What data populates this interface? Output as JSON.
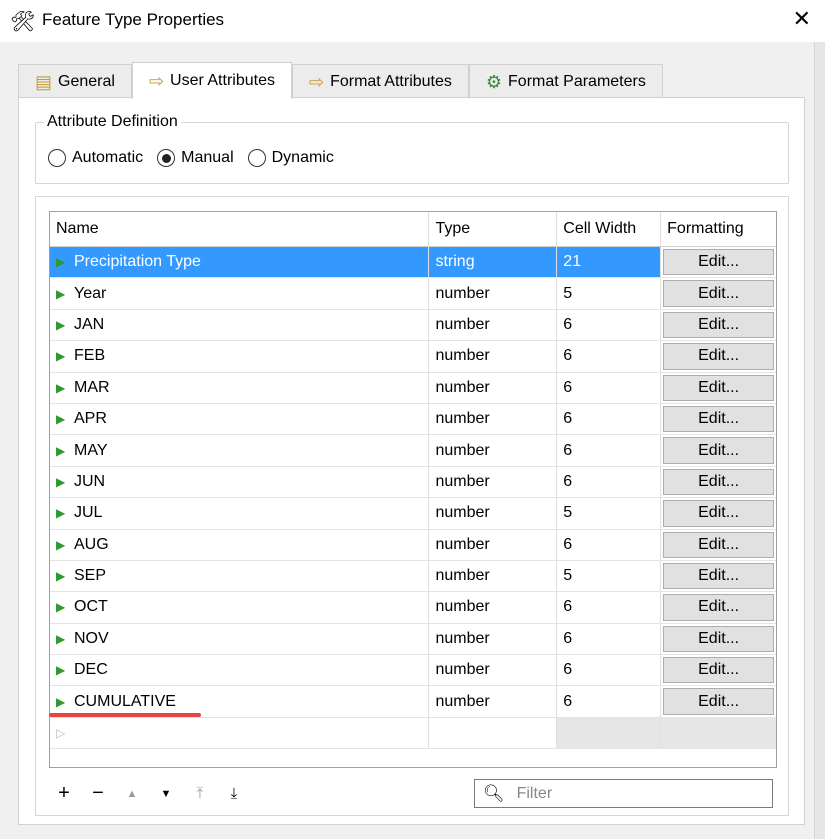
{
  "window": {
    "title": "Feature Type Properties",
    "close": "✕"
  },
  "tabs": [
    {
      "label": "General",
      "icon": "▤"
    },
    {
      "label": "User Attributes",
      "icon": "⇨"
    },
    {
      "label": "Format Attributes",
      "icon": "⇨"
    },
    {
      "label": "Format Parameters",
      "icon": "⚙"
    }
  ],
  "attr_def": {
    "label": "Attribute Definition",
    "options": [
      "Automatic",
      "Manual",
      "Dynamic"
    ],
    "selected": "Manual"
  },
  "table": {
    "headers": [
      "Name",
      "Type",
      "Cell Width",
      "Formatting"
    ],
    "rows": [
      {
        "name": "Precipitation Type",
        "type": "string",
        "width": "21",
        "fmt": "Edit..."
      },
      {
        "name": "Year",
        "type": "number",
        "width": "5",
        "fmt": "Edit..."
      },
      {
        "name": "JAN",
        "type": "number",
        "width": "6",
        "fmt": "Edit..."
      },
      {
        "name": "FEB",
        "type": "number",
        "width": "6",
        "fmt": "Edit..."
      },
      {
        "name": "MAR",
        "type": "number",
        "width": "6",
        "fmt": "Edit..."
      },
      {
        "name": "APR",
        "type": "number",
        "width": "6",
        "fmt": "Edit..."
      },
      {
        "name": "MAY",
        "type": "number",
        "width": "6",
        "fmt": "Edit..."
      },
      {
        "name": "JUN",
        "type": "number",
        "width": "6",
        "fmt": "Edit..."
      },
      {
        "name": "JUL",
        "type": "number",
        "width": "5",
        "fmt": "Edit..."
      },
      {
        "name": "AUG",
        "type": "number",
        "width": "6",
        "fmt": "Edit..."
      },
      {
        "name": "SEP",
        "type": "number",
        "width": "5",
        "fmt": "Edit..."
      },
      {
        "name": "OCT",
        "type": "number",
        "width": "6",
        "fmt": "Edit..."
      },
      {
        "name": "NOV",
        "type": "number",
        "width": "6",
        "fmt": "Edit..."
      },
      {
        "name": "DEC",
        "type": "number",
        "width": "6",
        "fmt": "Edit..."
      },
      {
        "name": "CUMULATIVE",
        "type": "number",
        "width": "6",
        "fmt": "Edit..."
      }
    ]
  },
  "toolbar": {
    "add": "+",
    "remove": "−",
    "up": "▲",
    "down": "▼",
    "top": "⤒",
    "bottom": "⤓"
  },
  "filter": {
    "placeholder": "Filter",
    "value": ""
  },
  "colors": {
    "selection": "#3399ff",
    "annotation": "#e8433f"
  }
}
